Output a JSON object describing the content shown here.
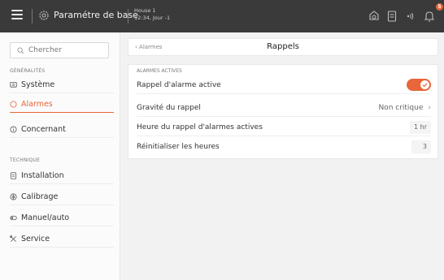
{
  "header": {
    "title": "Paramétre de base",
    "location": "House 1",
    "datetime": "12:34, Jour -1",
    "alarm_count": "5",
    "accent_color": "#e8663a"
  },
  "sidebar": {
    "search_placeholder": "Chercher",
    "general_label": "GÉNÉRALITÉS",
    "general_items": [
      {
        "label": "Système",
        "icon": "system-icon"
      },
      {
        "label": "Alarmes",
        "icon": "alarm-icon",
        "active": true
      },
      {
        "label": "Concernant",
        "icon": "info-icon"
      }
    ],
    "technical_label": "TECHNIQUE",
    "technical_items": [
      {
        "label": "Installation",
        "icon": "installation-icon"
      },
      {
        "label": "Calibrage",
        "icon": "calibration-icon"
      },
      {
        "label": "Manuel/auto",
        "icon": "manual-auto-icon"
      },
      {
        "label": "Service",
        "icon": "service-icon"
      }
    ]
  },
  "main": {
    "breadcrumb": "Alarmes",
    "title": "Rappels",
    "section_label": "ALARMES ACTIVES",
    "rows": [
      {
        "label": "Rappel d'alarme active",
        "type": "toggle",
        "value": true
      },
      {
        "label": "Gravité du rappel",
        "type": "select",
        "value": "Non critique"
      },
      {
        "label": "Heure du rappel d'alarmes actives",
        "type": "number",
        "value": "1 hr"
      },
      {
        "label": "Réinitialiser les heures",
        "type": "number",
        "value": "3"
      }
    ]
  }
}
